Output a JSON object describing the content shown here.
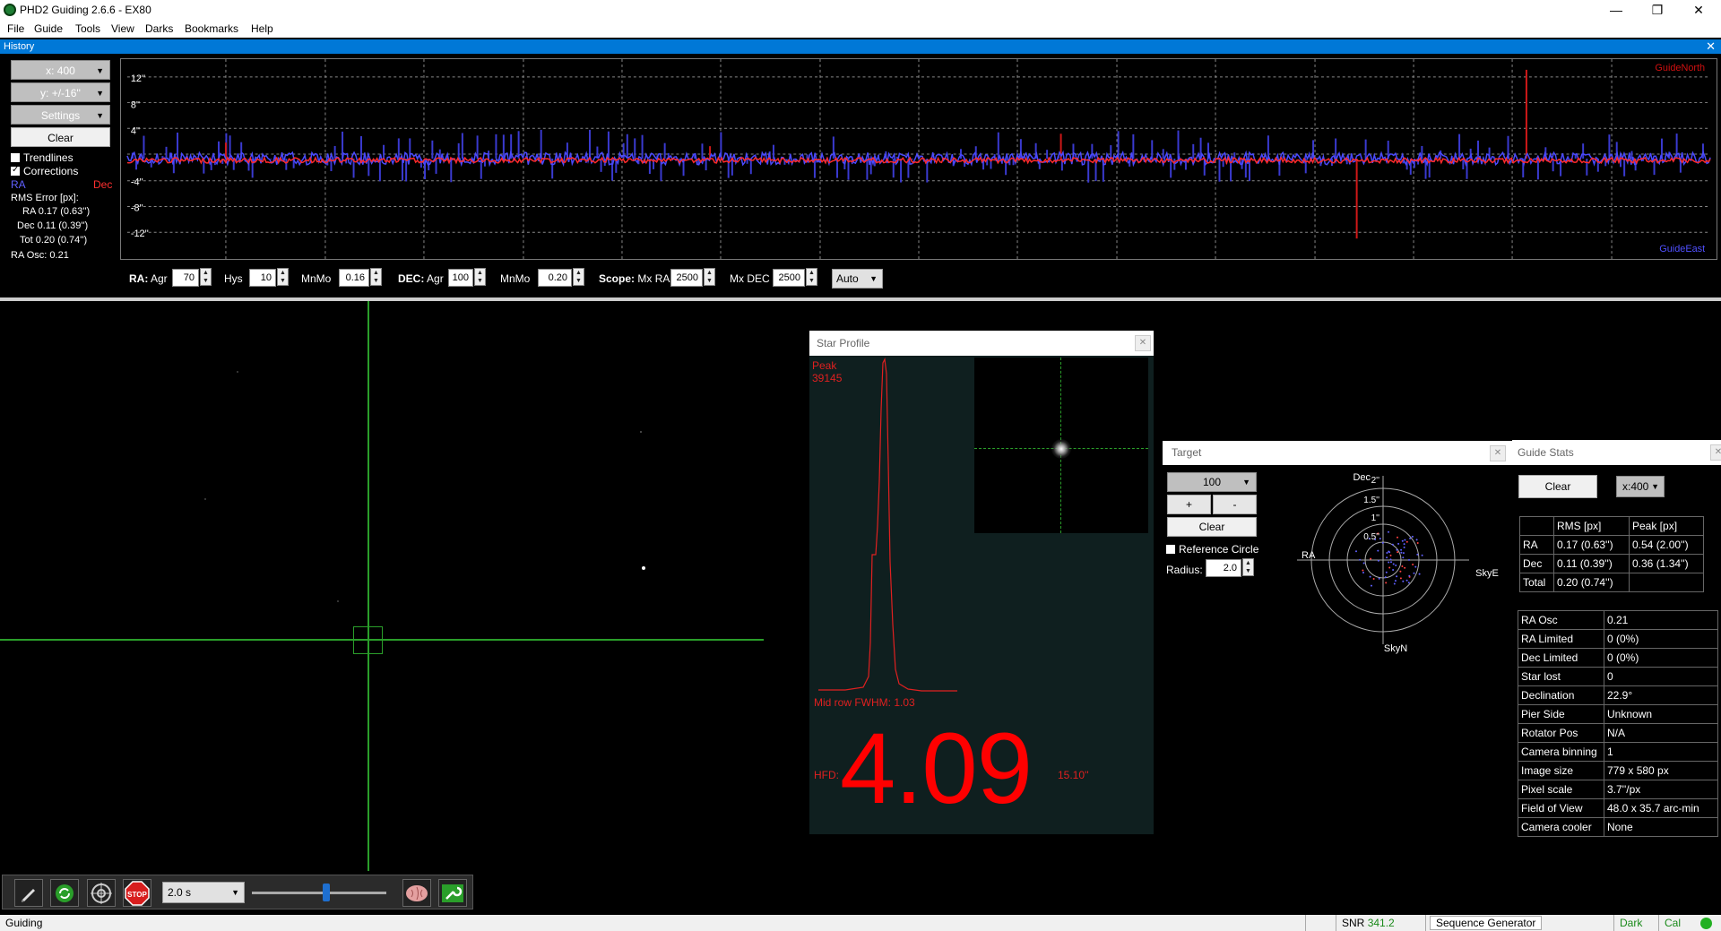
{
  "window": {
    "title": "PHD2 Guiding 2.6.6 - EX80",
    "minimize": "—",
    "maximize": "❐",
    "close": "✕"
  },
  "menu": [
    "File",
    "Guide",
    "Tools",
    "View",
    "Darks",
    "Bookmarks",
    "Help"
  ],
  "history": {
    "title": "History",
    "close": "✕",
    "x_scale": "x: 400",
    "y_scale": "y: +/-16''",
    "settings": "Settings",
    "clear": "Clear",
    "trendlines": "Trendlines",
    "corrections": "Corrections",
    "legend_ra": "RA",
    "legend_dec": "Dec",
    "rms_title": "RMS Error [px]:",
    "rms_ra": "RA 0.17 (0.63'')",
    "rms_dec": "Dec 0.11 (0.39'')",
    "rms_tot": "Tot 0.20 (0.74'')",
    "ra_osc": "RA Osc: 0.21",
    "y_ticks": [
      "12''",
      "8''",
      "4''",
      "-4''",
      "-8''",
      "-12''"
    ],
    "guide_north": "GuideNorth",
    "guide_east": "GuideEast",
    "colors": {
      "ra": "#4040ff",
      "dec": "#ff2020",
      "grid": "#aaaaaa"
    }
  },
  "params": {
    "ra_label": "RA:",
    "agr_label": "Agr",
    "ra_agr": "70",
    "hys_label": "Hys",
    "hys": "10",
    "mnmo_label": "MnMo",
    "ra_mnmo": "0.16",
    "dec_label": "DEC:",
    "dec_agr": "100",
    "dec_mnmo": "0.20",
    "scope_label": "Scope:",
    "mxra_label": "Mx RA",
    "mx_ra": "2500",
    "mxdec_label": "Mx DEC",
    "mx_dec": "2500",
    "mode": "Auto"
  },
  "star_profile": {
    "title": "Star Profile",
    "peak_label": "Peak",
    "peak_value": "39145",
    "fwhm": "Mid row FWHM: 1.03",
    "hfd_label": "HFD:",
    "hfd_value": "4.09",
    "hfd_arcsec": "15.10''"
  },
  "target": {
    "title": "Target",
    "zoom": "100",
    "plus": "+",
    "minus": "-",
    "clear": "Clear",
    "ref_circle": "Reference Circle",
    "radius_label": "Radius:",
    "radius": "2.0",
    "axis_dec": "Dec",
    "axis_ra": "RA",
    "axis_skye": "SkyE",
    "axis_skyn": "SkyN",
    "ring_labels": [
      "2''",
      "1.5''",
      "1''",
      "0.5''"
    ]
  },
  "guide_stats": {
    "title": "Guide Stats",
    "clear": "Clear",
    "x_scale": "x:400",
    "headers": [
      "",
      "RMS [px]",
      "Peak [px]"
    ],
    "rows": [
      [
        "RA",
        "0.17 (0.63'')",
        "0.54 (2.00'')"
      ],
      [
        "Dec",
        "0.11 (0.39'')",
        "0.36 (1.34'')"
      ],
      [
        "Total",
        "0.20 (0.74'')",
        ""
      ]
    ],
    "info": [
      [
        "RA Osc",
        "0.21"
      ],
      [
        "RA Limited",
        "0 (0%)"
      ],
      [
        "Dec Limited",
        "0 (0%)"
      ],
      [
        "Star lost",
        "0"
      ],
      [
        "Declination",
        "22.9°"
      ],
      [
        "Pier Side",
        "Unknown"
      ],
      [
        "Rotator Pos",
        "N/A"
      ],
      [
        "Camera binning",
        "1"
      ],
      [
        "Image size",
        "779 x 580 px"
      ],
      [
        "Pixel scale",
        "3.7''/px"
      ],
      [
        "Field of View",
        "48.0 x  35.7  arc-min"
      ],
      [
        "Camera cooler",
        "None"
      ]
    ]
  },
  "toolbar": {
    "exposure": "2.0 s",
    "stop": "STOP",
    "exposure_level": 0.55
  },
  "status": {
    "state": "Guiding",
    "snr_label": "SNR",
    "snr": "341.2",
    "seq": "Sequence Generator",
    "dark": "Dark",
    "cal": "Cal"
  }
}
